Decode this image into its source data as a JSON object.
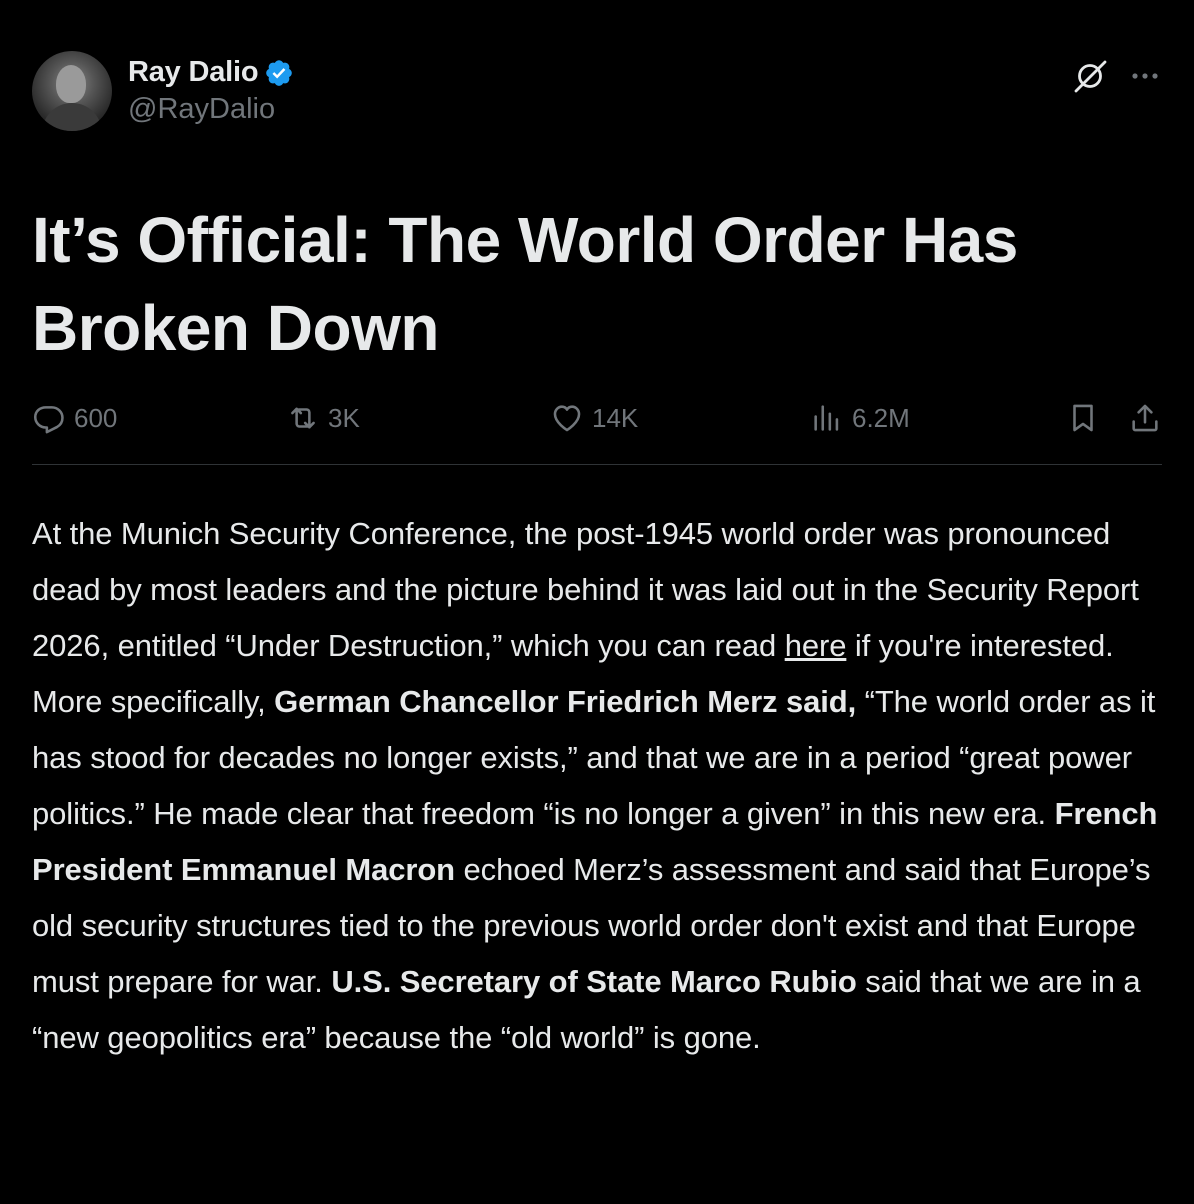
{
  "author": {
    "display_name": "Ray Dalio",
    "handle": "@RayDalio",
    "verified": true
  },
  "icons": {
    "verified": "verified-badge-icon",
    "grok": "grok-icon",
    "more": "more-options-icon",
    "reply": "reply-icon",
    "repost": "repost-icon",
    "like": "heart-icon",
    "views": "views-icon",
    "bookmark": "bookmark-icon",
    "share": "share-icon"
  },
  "colors": {
    "background": "#000000",
    "text": "#e7e9ea",
    "muted": "#71767b",
    "verified": "#1d9bf0",
    "divider": "#2f3336"
  },
  "article": {
    "title": "It’s Official: The World Order Has Broken Down",
    "p1_a": "At the Munich Security Conference, the post-1945 world order was pronounced dead by most leaders and the picture behind it was laid out in the Security Report 2026, entitled “Under Destruction,” which you can read ",
    "p1_link": "here",
    "p1_b": " if you're interested.  More specifically, ",
    "p1_bold1": "German Chancellor Friedrich Merz said,",
    "p1_c": " “The world order as it has stood for decades no longer exists,” and that we are in a period “great power politics.”   He made clear that freedom “is no longer a given” in this new era. ",
    "p1_bold2": "French President Emmanuel Macron",
    "p1_d": " echoed Merz’s assessment and said that Europe’s old security structures tied to the previous world order don't exist and that Europe must prepare for war. ",
    "p1_bold3": "U.S. Secretary of State Marco Rubio",
    "p1_e": " said that we are in a “new geopolitics era” because the “old world” is gone."
  },
  "stats": {
    "replies": "600",
    "reposts": "3K",
    "likes": "14K",
    "views": "6.2M"
  }
}
